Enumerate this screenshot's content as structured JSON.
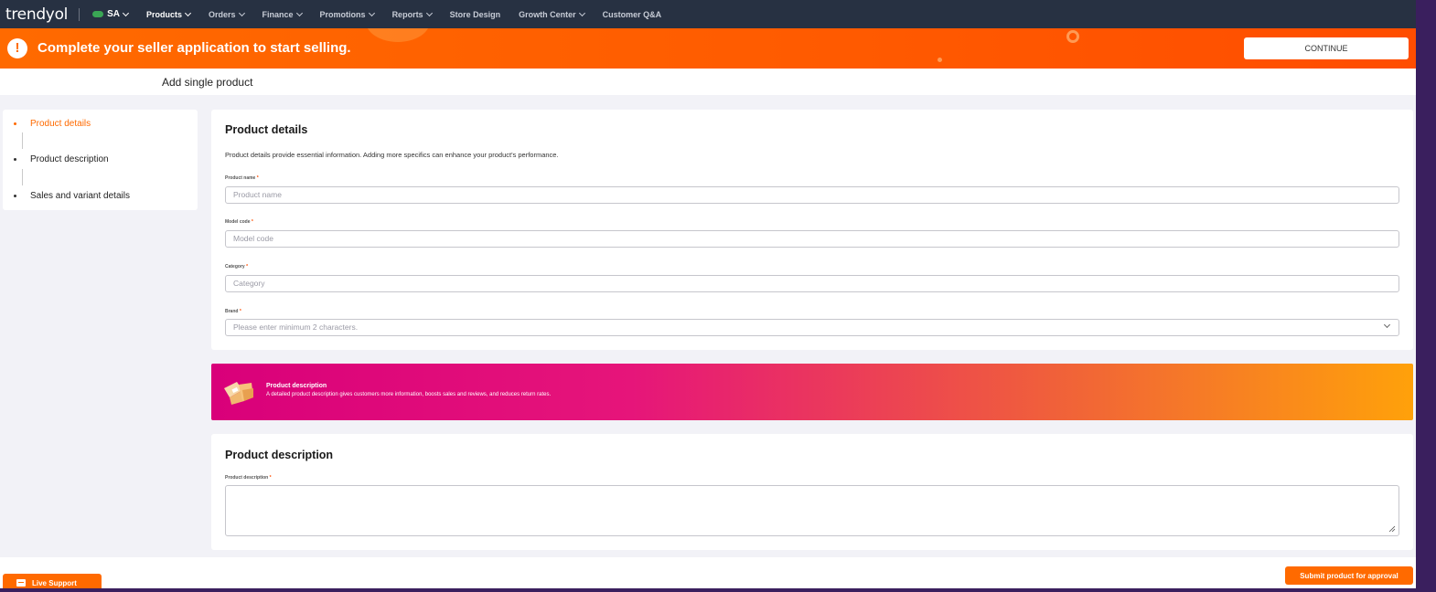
{
  "topnav": {
    "logo": "trendyol",
    "country": "SA",
    "items": [
      {
        "label": "Products",
        "active": true,
        "dropdown": true
      },
      {
        "label": "Orders",
        "active": false,
        "dropdown": true
      },
      {
        "label": "Finance",
        "active": false,
        "dropdown": true
      },
      {
        "label": "Promotions",
        "active": false,
        "dropdown": true
      },
      {
        "label": "Reports",
        "active": false,
        "dropdown": true
      },
      {
        "label": "Store Design",
        "active": false,
        "dropdown": false
      },
      {
        "label": "Growth Center",
        "active": false,
        "dropdown": true
      },
      {
        "label": "Customer Q&A",
        "active": false,
        "dropdown": false
      }
    ]
  },
  "banner": {
    "message": "Complete your seller application to start selling.",
    "button_label": "CONTINUE"
  },
  "page": {
    "title": "Add single product"
  },
  "stepper": {
    "steps": [
      {
        "label": "Product details",
        "active": true
      },
      {
        "label": "Product description",
        "active": false
      },
      {
        "label": "Sales and variant details",
        "active": false
      }
    ]
  },
  "details": {
    "title": "Product details",
    "subtitle": "Product details provide essential information. Adding more specifics can enhance your product's performance.",
    "fields": [
      {
        "label": "Product name",
        "placeholder": "Product name"
      },
      {
        "label": "Model code",
        "placeholder": "Model code"
      },
      {
        "label": "Category",
        "placeholder": "Category"
      },
      {
        "label": "Brand",
        "placeholder": "Please enter minimum 2 characters."
      }
    ],
    "required_mark": "*"
  },
  "promo": {
    "title": "Product description",
    "text": "A detailed product description gives customers more information, boosts sales and reviews, and reduces return rates."
  },
  "description": {
    "title": "Product description",
    "field_label": "Product description",
    "required_mark": "*"
  },
  "footer": {
    "live_support": "Live Support",
    "submit": "Submit product for approval"
  },
  "colors": {
    "accent": "#ff6a00",
    "nav_bg": "#273142"
  }
}
